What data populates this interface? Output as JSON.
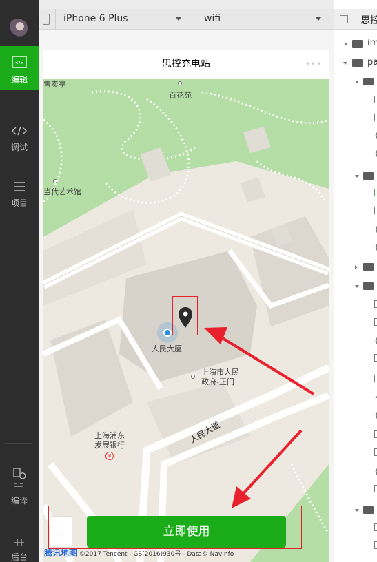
{
  "sidebar": {
    "items": [
      {
        "label": "编辑",
        "icon": "code-editor-icon"
      },
      {
        "label": "调试",
        "icon": "code-brackets-icon"
      },
      {
        "label": "项目",
        "icon": "hamburger-icon"
      },
      {
        "label": "编译",
        "icon": "compile-icon"
      },
      {
        "label": "后台",
        "icon": "backend-icon"
      }
    ]
  },
  "toolbar": {
    "device": "iPhone 6 Plus",
    "network": "wifi"
  },
  "phone": {
    "nav_title": "思控充电站",
    "capsule": "•••"
  },
  "map": {
    "labels": {
      "kiosk": "售卖亭",
      "garden": "百花苑",
      "museum": "当代艺术馆",
      "renmin_building": "人民大厦",
      "gov_gate_line1": "上海市人民",
      "gov_gate_line2": "政府-正门",
      "bank_line1": "上海浦东",
      "bank_line2": "发展银行",
      "road": "人民大道",
      "bank_badge": "¥"
    }
  },
  "bottom": {
    "small_button": ".",
    "use_button": "立即使用",
    "attribution_logo": "腾讯地图",
    "attribution_text": "©2017 Tencent - GS(2016)930号 - Data© NavInfo"
  },
  "tree": {
    "title": "思控",
    "root_items": [
      {
        "label": "im"
      },
      {
        "label": "pa"
      }
    ]
  },
  "colors": {
    "accent_green": "#1aad19",
    "annotation_red": "#e8212d",
    "sidebar_bg": "#2d2d2d"
  }
}
